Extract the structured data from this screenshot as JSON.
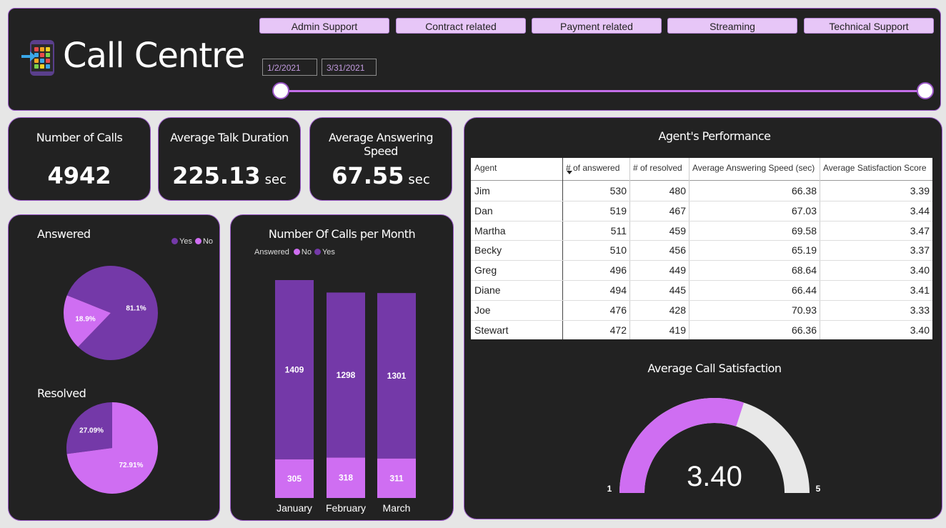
{
  "header": {
    "title": "Call Centre",
    "filters": [
      "Admin Support",
      "Contract related",
      "Payment related",
      "Streaming",
      "Technical Support"
    ],
    "date_start": "1/2/2021",
    "date_end": "3/31/2021"
  },
  "kpis": [
    {
      "label": "Number of Calls",
      "value": "4942",
      "unit": ""
    },
    {
      "label": "Average Talk Duration",
      "value": "225.13",
      "unit": "sec"
    },
    {
      "label": "Average Answering Speed",
      "value": "67.55",
      "unit": "sec"
    }
  ],
  "colors": {
    "purple_dark": "#7439a8",
    "purple_light": "#cf6ef2",
    "gauge_empty": "#e8e8e8",
    "accent": "#c36ee8"
  },
  "chart_data": [
    {
      "type": "pie",
      "title": "Answered",
      "legend": [
        "Yes",
        "No"
      ],
      "slices": [
        {
          "label": "Yes",
          "value": 81.1,
          "text": "81.1%"
        },
        {
          "label": "No",
          "value": 18.9,
          "text": "18.9%"
        }
      ]
    },
    {
      "type": "pie",
      "title": "Resolved",
      "slices": [
        {
          "label": "No",
          "value": 27.09,
          "text": "27.09%"
        },
        {
          "label": "Yes",
          "value": 72.91,
          "text": "72.91%"
        }
      ]
    },
    {
      "type": "bar",
      "title": "Number Of Calls per Month",
      "legend_title": "Answered",
      "categories": [
        "January",
        "February",
        "March"
      ],
      "series": [
        {
          "name": "No",
          "values": [
            305,
            318,
            311
          ]
        },
        {
          "name": "Yes",
          "values": [
            1409,
            1298,
            1301
          ]
        }
      ],
      "stacked": true
    },
    {
      "type": "table",
      "title": "Agent's Performance",
      "columns": [
        "Agent",
        "# of answered",
        "# of resolved",
        "Average Answering Speed (sec)",
        "Average Satisfaction Score"
      ],
      "rows": [
        [
          "Jim",
          "530",
          "480",
          "66.38",
          "3.39"
        ],
        [
          "Dan",
          "519",
          "467",
          "67.03",
          "3.44"
        ],
        [
          "Martha",
          "511",
          "459",
          "69.58",
          "3.47"
        ],
        [
          "Becky",
          "510",
          "456",
          "65.19",
          "3.37"
        ],
        [
          "Greg",
          "496",
          "449",
          "68.64",
          "3.40"
        ],
        [
          "Diane",
          "494",
          "445",
          "66.44",
          "3.41"
        ],
        [
          "Joe",
          "476",
          "428",
          "70.93",
          "3.33"
        ],
        [
          "Stewart",
          "472",
          "419",
          "66.36",
          "3.40"
        ]
      ]
    },
    {
      "type": "gauge",
      "title": "Average Call Satisfaction",
      "value": 3.4,
      "value_text": "3.40",
      "min": 1,
      "max": 5,
      "min_text": "1",
      "max_text": "5"
    }
  ]
}
